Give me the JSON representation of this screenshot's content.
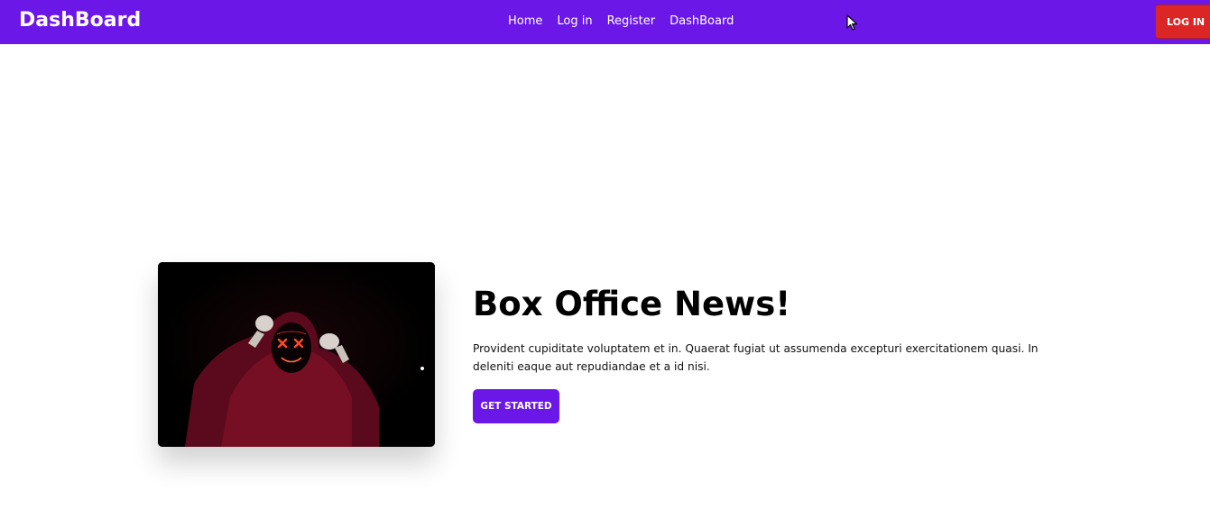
{
  "navbar": {
    "brand": "DashBoard",
    "links": [
      "Home",
      "Log in",
      "Register",
      "DashBoard"
    ],
    "login_button": "LOG IN"
  },
  "hero": {
    "title": "Box Office News!",
    "text": "Provident cupiditate voluptatem et in. Quaerat fugiat ut assumenda excepturi exercitationem quasi. In deleniti eaque aut repudiandae et a id nisi.",
    "button": "GET STARTED"
  },
  "colors": {
    "primary": "#6a17e8",
    "danger": "#dc2626"
  }
}
